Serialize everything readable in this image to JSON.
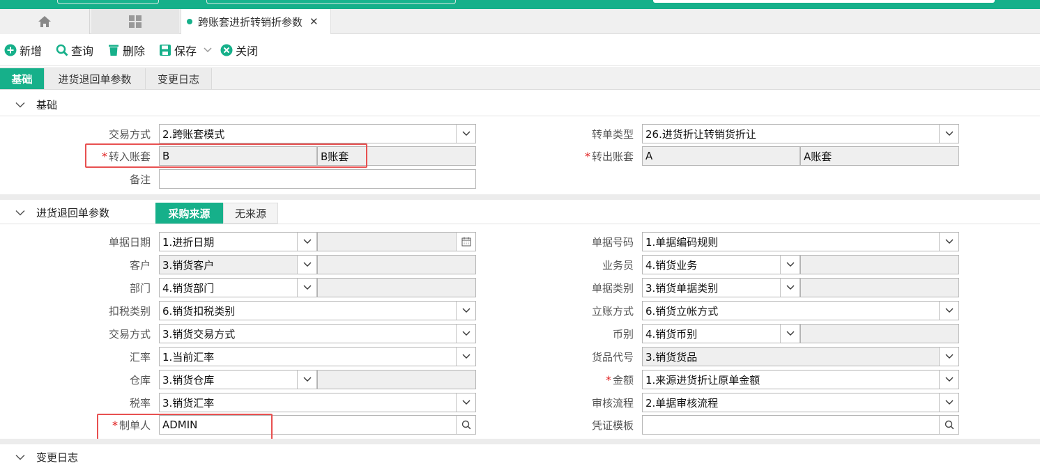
{
  "window": {
    "active_tab": "跨账套进折转销折参数"
  },
  "toolbar": {
    "new": "新增",
    "query": "查询",
    "delete": "删除",
    "save": "保存",
    "close": "关闭"
  },
  "subtabs": [
    "基础",
    "进货退回单参数",
    "变更日志"
  ],
  "section_basic": {
    "title": "基础",
    "fields": {
      "trade_mode": {
        "label": "交易方式",
        "value": "2.跨账套模式"
      },
      "transfer_type": {
        "label": "转单类型",
        "value": "26.进货折让转销货折让"
      },
      "in_book": {
        "label": "转入账套",
        "code": "B",
        "name": "B账套"
      },
      "out_book": {
        "label": "转出账套",
        "code": "A",
        "name": "A账套"
      },
      "remark": {
        "label": "备注",
        "value": ""
      }
    }
  },
  "section_return": {
    "title": "进货退回单参数",
    "toggle": [
      "采购来源",
      "无来源"
    ],
    "left": [
      {
        "label": "单据日期",
        "value": "1.进折日期"
      },
      {
        "label": "客户",
        "value": "3.销货客户"
      },
      {
        "label": "部门",
        "value": "4.销货部门"
      },
      {
        "label": "扣税类别",
        "value": "6.销货扣税类别"
      },
      {
        "label": "交易方式",
        "value": "3.销货交易方式"
      },
      {
        "label": "汇率",
        "value": "1.当前汇率"
      },
      {
        "label": "仓库",
        "value": "3.销货仓库"
      },
      {
        "label": "税率",
        "value": "3.销货汇率"
      },
      {
        "label": "制单人",
        "value": "ADMIN"
      }
    ],
    "right": [
      {
        "label": "单据号码",
        "value": "1.单据编码规则"
      },
      {
        "label": "业务员",
        "value": "4.销货业务"
      },
      {
        "label": "单据类别",
        "value": "3.销货单据类别"
      },
      {
        "label": "立账方式",
        "value": "6.销货立帐方式"
      },
      {
        "label": "币别",
        "value": "4.销货币别"
      },
      {
        "label": "货品代号",
        "value": "3.销货货品"
      },
      {
        "label": "金额",
        "value": "1.来源进货折让原单金额"
      },
      {
        "label": "审核流程",
        "value": "2.单据审核流程"
      },
      {
        "label": "凭证模板",
        "value": ""
      }
    ]
  },
  "section_log": {
    "title": "变更日志"
  },
  "colors": {
    "accent": "#16b08a",
    "required": "#e02020",
    "highlight_box": "#e85050"
  }
}
